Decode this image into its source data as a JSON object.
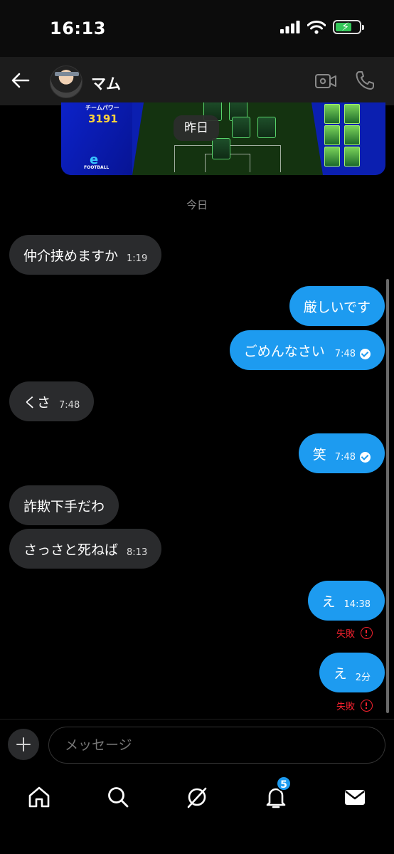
{
  "status_bar": {
    "time": "16:13"
  },
  "header": {
    "contact_name": "マム"
  },
  "shared_image": {
    "team_power_label": "チームパワー",
    "team_power_value": "3191",
    "logo_text": "FOOTBALL",
    "yesterday_label": "昨日"
  },
  "divider": {
    "today_label": "今日"
  },
  "messages": [
    {
      "direction": "in",
      "text": "仲介挟めますか",
      "time": "1:19"
    },
    {
      "direction": "out",
      "text": "厳しいです",
      "time": ""
    },
    {
      "direction": "out",
      "text": "ごめんなさい",
      "time": "7:48",
      "read": true
    },
    {
      "direction": "in",
      "text": "くさ",
      "time": "7:48"
    },
    {
      "direction": "out",
      "text": "笑",
      "time": "7:48",
      "read": true
    },
    {
      "direction": "in",
      "text": "詐欺下手だわ",
      "time": ""
    },
    {
      "direction": "in",
      "text": "さっさと死ねば",
      "time": "8:13"
    },
    {
      "direction": "out",
      "text": "え",
      "time": "14:38",
      "status": "失敗"
    },
    {
      "direction": "out",
      "text": "え",
      "time": "2分",
      "status": "失敗"
    }
  ],
  "composer": {
    "placeholder": "メッセージ"
  },
  "tab_bar": {
    "items": [
      "home-icon",
      "search-icon",
      "grok-icon",
      "notifications-icon",
      "messages-icon"
    ],
    "notification_count": "5"
  },
  "colors": {
    "outgoing_bubble": "#1d9bf0",
    "incoming_bubble": "#2a2b2d",
    "failed": "#f4212e",
    "background": "#000000"
  }
}
